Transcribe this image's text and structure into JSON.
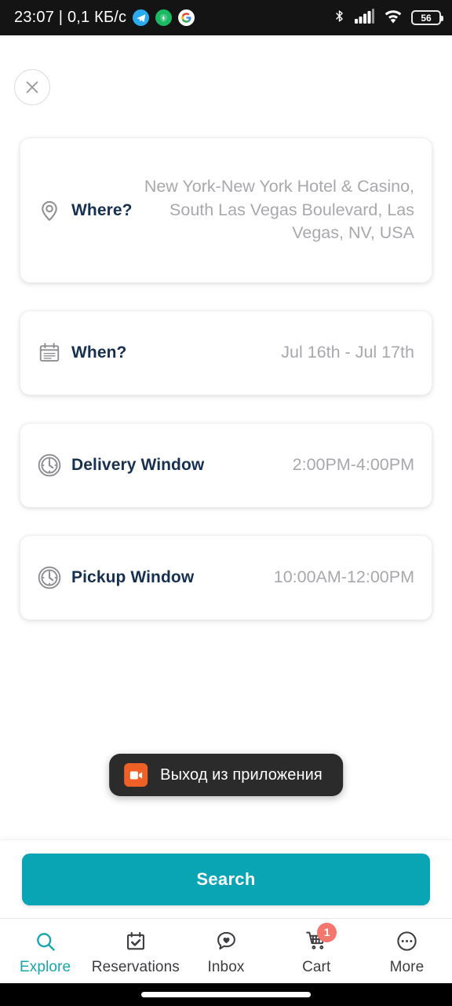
{
  "status_bar": {
    "clock": "23:07 | 0,1 КБ/c",
    "battery_level": "56",
    "app_icons": [
      "telegram-icon",
      "shield-icon",
      "google-icon"
    ],
    "right_icons": [
      "bluetooth-icon",
      "cellular-signal-icon",
      "wifi-icon",
      "battery-icon"
    ],
    "background": "#141414"
  },
  "header": {
    "close_label": "close-icon"
  },
  "search_form": {
    "cards": [
      {
        "icon": "map-pin-icon",
        "label": "Where?",
        "value": "New York-New York Hotel & Casino, South Las Vegas Boulevard, Las Vegas, NV, USA"
      },
      {
        "icon": "calendar-icon",
        "label": "When?",
        "value": "Jul 16th - Jul 17th"
      },
      {
        "icon": "clock-icon",
        "label": "Delivery Window",
        "value": "2:00PM-4:00PM"
      },
      {
        "icon": "clock-icon",
        "label": "Pickup Window",
        "value": "10:00AM-12:00PM"
      }
    ],
    "submit_label": "Search",
    "submit_color": "#0aa5b5"
  },
  "toast": {
    "icon": "video-camera-icon",
    "text": "Выход из приложения",
    "background": "#2b2b2b",
    "icon_color": "#ef6027"
  },
  "bottom_nav": {
    "active_color": "#17a5ae",
    "items": [
      {
        "icon": "search-icon",
        "label": "Explore",
        "active": true,
        "badge": ""
      },
      {
        "icon": "calendar-check-icon",
        "label": "Reservations",
        "active": false,
        "badge": ""
      },
      {
        "icon": "chat-heart-icon",
        "label": "Inbox",
        "active": false,
        "badge": ""
      },
      {
        "icon": "shopping-cart-icon",
        "label": "Cart",
        "active": false,
        "badge": "1"
      },
      {
        "icon": "ellipsis-circle-icon",
        "label": "More",
        "active": false,
        "badge": ""
      }
    ]
  }
}
